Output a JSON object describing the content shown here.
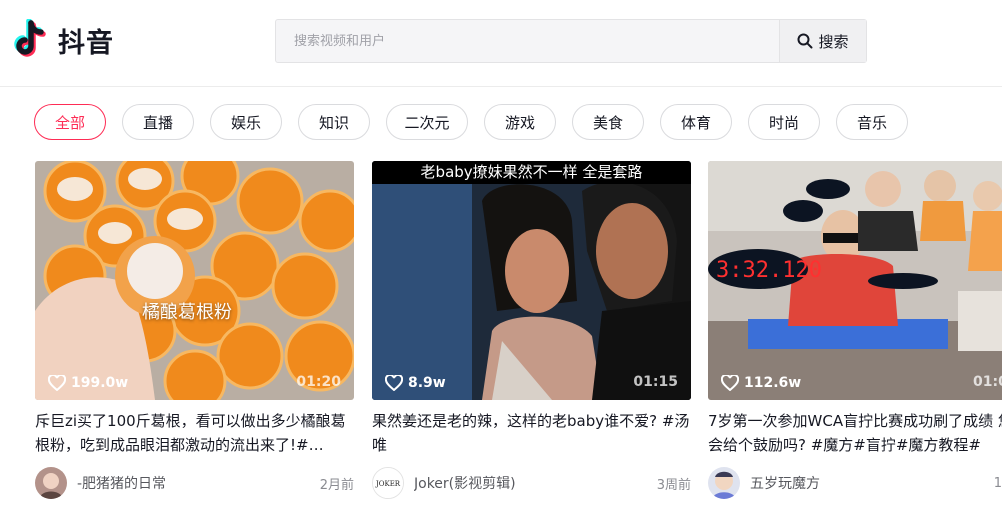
{
  "app": {
    "name": "抖音",
    "accent": "#fe2c55"
  },
  "search": {
    "placeholder": "搜索视频和用户",
    "button_label": "搜索"
  },
  "categories": [
    {
      "label": "全部",
      "active": true
    },
    {
      "label": "直播"
    },
    {
      "label": "娱乐"
    },
    {
      "label": "知识"
    },
    {
      "label": "二次元"
    },
    {
      "label": "游戏"
    },
    {
      "label": "美食"
    },
    {
      "label": "体育"
    },
    {
      "label": "时尚"
    },
    {
      "label": "音乐"
    }
  ],
  "videos": [
    {
      "overlay": "橘酿葛根粉",
      "likes": "199.0w",
      "duration": "01:20",
      "title": "斥巨zi买了100斤葛根，看可以做出多少橘酿葛根粉，吃到成品眼泪都激动的流出来了!#…",
      "author": "-肥猪猪的日常",
      "time": "2月前"
    },
    {
      "banner": "老baby撩妹果然不一样 全是套路",
      "likes": "8.9w",
      "duration": "01:15",
      "title": "果然姜还是老的辣，这样的老baby谁不爱? #汤唯",
      "author": "Joker(影视剪辑)",
      "time": "3周前",
      "avatar_text": "JOKER"
    },
    {
      "timer": "3:32.120",
      "likes": "112.6w",
      "duration": "01:0",
      "title": "7岁第一次参加WCA盲拧比赛成功刷了成绩 您会给个鼓励吗? #魔方#盲拧#魔方教程#",
      "author": "五岁玩魔方",
      "time": "1"
    }
  ]
}
